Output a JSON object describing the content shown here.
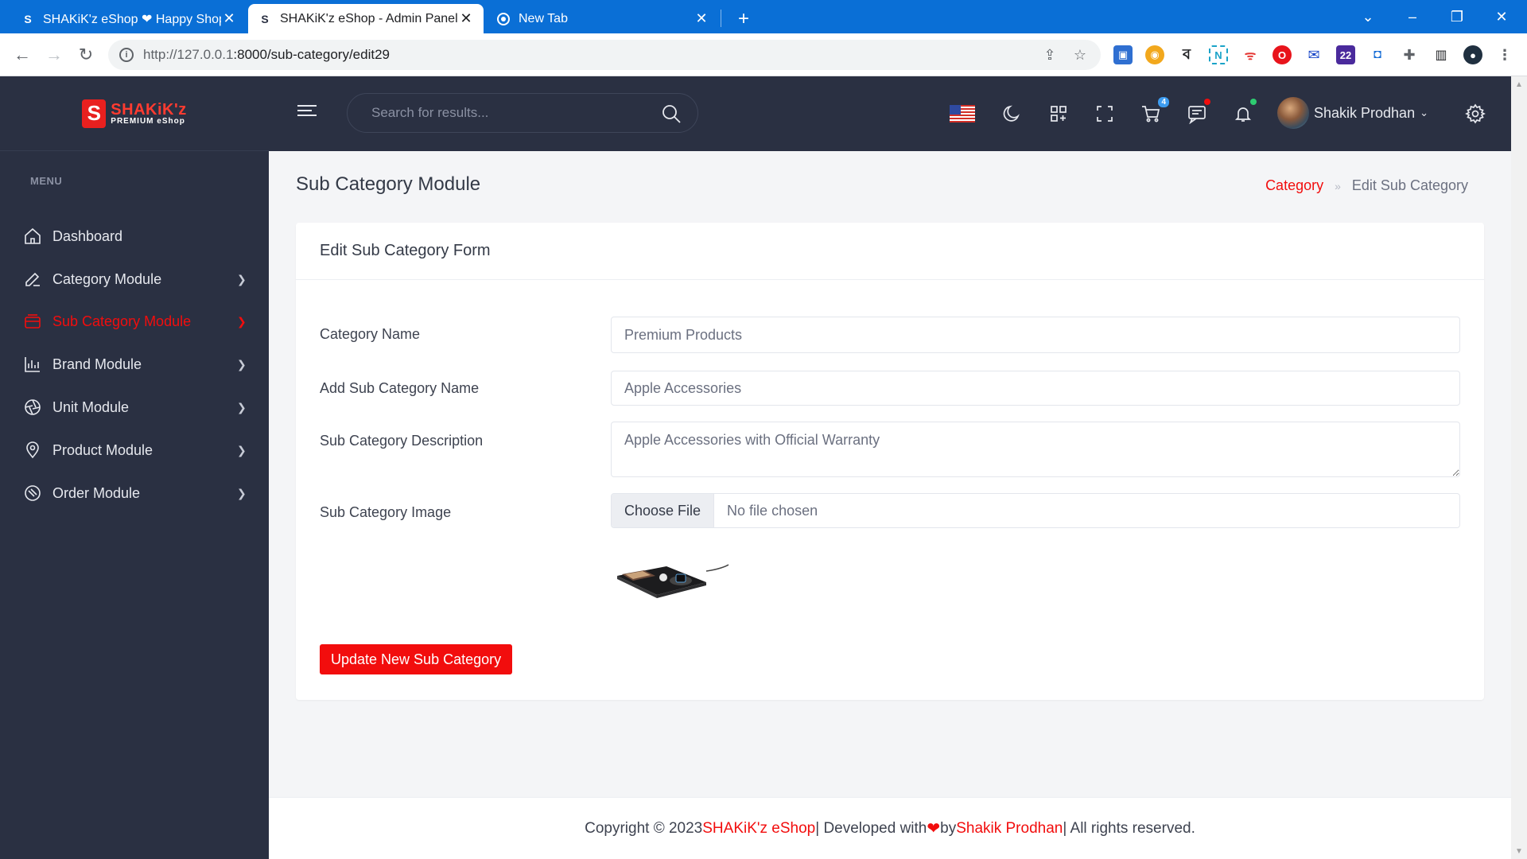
{
  "browser": {
    "tabs": [
      {
        "title": "SHAKiK'z eShop ❤ Happy Shop",
        "active": false
      },
      {
        "title": "SHAKiK'z eShop - Admin Panel",
        "active": true
      },
      {
        "title": "New Tab",
        "active": false
      }
    ],
    "new_tab": "+",
    "url_host": "http://127.0.0.1",
    "url_path": ":8000/sub-category/edit29"
  },
  "sidebar": {
    "logo_line1": "SHAKiK'z",
    "logo_line2": "PREMIUM eShop",
    "menu_title": "MENU",
    "items": [
      {
        "label": "Dashboard",
        "icon": "home-icon",
        "has_children": false
      },
      {
        "label": "Category Module",
        "icon": "edit-icon",
        "has_children": true
      },
      {
        "label": "Sub Category Module",
        "icon": "layers-icon",
        "has_children": true,
        "active": true
      },
      {
        "label": "Brand Module",
        "icon": "bar-chart-icon",
        "has_children": true
      },
      {
        "label": "Unit Module",
        "icon": "aperture-icon",
        "has_children": true
      },
      {
        "label": "Product Module",
        "icon": "map-pin-icon",
        "has_children": true
      },
      {
        "label": "Order Module",
        "icon": "target-icon",
        "has_children": true
      }
    ]
  },
  "topbar": {
    "search_placeholder": "Search for results...",
    "cart_count": "4",
    "user_name": "Shakik Prodhan"
  },
  "page": {
    "title": "Sub Category Module",
    "breadcrumb_link": "Category",
    "breadcrumb_current": "Edit Sub Category"
  },
  "form": {
    "header": "Edit Sub Category Form",
    "category_label": "Category Name",
    "category_value": "Premium Products",
    "name_label": "Add Sub Category Name",
    "name_value": "Apple Accessories",
    "description_label": "Sub Category Description",
    "description_value": "Apple Accessories with Official Warranty",
    "image_label": "Sub Category Image",
    "file_button": "Choose File",
    "file_status": "No file chosen",
    "submit_label": "Update New Sub Category"
  },
  "footer": {
    "prefix": "Copyright © 2023 ",
    "brand": "SHAKiK'z eShop",
    "middle1": " | Developed with ",
    "middle2": " by ",
    "author": "Shakik Prodhan",
    "suffix": " | All rights reserved."
  },
  "colors": {
    "accent": "#f20d0d",
    "sidebar_bg": "#2a3042",
    "tabstrip_bg": "#0a6fd6"
  }
}
